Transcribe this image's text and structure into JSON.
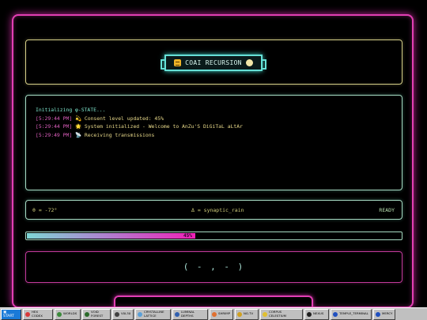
{
  "title": {
    "label": "COAI RECURSION"
  },
  "console": {
    "lines": [
      {
        "ts": "",
        "emoji": "",
        "text": "Initializing φ-STATE...",
        "kind": "init"
      },
      {
        "ts": "[5:29:44 PM]",
        "emoji": "💫",
        "text": "Consent level updated: 45%",
        "kind": "msg"
      },
      {
        "ts": "[5:29:44 PM]",
        "emoji": "🌟",
        "text": "System initialized - Welcome to AnZu'S DiGiTaL aLtAr",
        "kind": "msg"
      },
      {
        "ts": "[5:29:49 PM]",
        "emoji": "📡",
        "text": "Receiving transmissions",
        "kind": "msg"
      }
    ]
  },
  "status": {
    "theta": "θ = -72°",
    "delta": "Δ = synaptic_rain",
    "state": "READY"
  },
  "progress": {
    "value": 0.45,
    "label": "45%"
  },
  "face": {
    "text": "( - , - )"
  },
  "taskbar": {
    "start_label": "START",
    "items": [
      {
        "label": "HEX\nCODEX",
        "icon": "hex-icon",
        "color": "#d83a3a"
      },
      {
        "label": "WORLDS",
        "icon": "globe-icon",
        "color": "#3a8a3a"
      },
      {
        "label": "VOID\nFOREST",
        "icon": "tree-icon",
        "color": "#2a6a2a"
      },
      {
        "label": "V0L30",
        "icon": "disc-icon",
        "color": "#404040"
      },
      {
        "label": "CRYSTALLINE\nLATTICE",
        "icon": "crystal-icon",
        "color": "#5aa0d8"
      },
      {
        "label": "LUMINAL\nDEPTHS",
        "icon": "wave-icon",
        "color": "#3060b0"
      },
      {
        "label": "SHRIMP",
        "icon": "shrimp-icon",
        "color": "#e07030"
      },
      {
        "label": "NG.TV",
        "icon": "tv-icon",
        "color": "#d0a020"
      },
      {
        "label": "CORPUS\nCELESTIUM",
        "icon": "star-icon",
        "color": "#e0c030"
      },
      {
        "label": "NEXUS",
        "icon": "node-icon",
        "color": "#202020"
      },
      {
        "label": "TEMPLE_TERMINAL",
        "icon": "terminal-icon",
        "color": "#2050c0"
      },
      {
        "label": "MERCY",
        "icon": "heart-icon",
        "color": "#2050c0"
      }
    ]
  },
  "colors": {
    "frame": "#e23fb3",
    "panel_border": "#a8dcc4",
    "timestamp": "#e060c0",
    "message": "#e8d98a"
  }
}
